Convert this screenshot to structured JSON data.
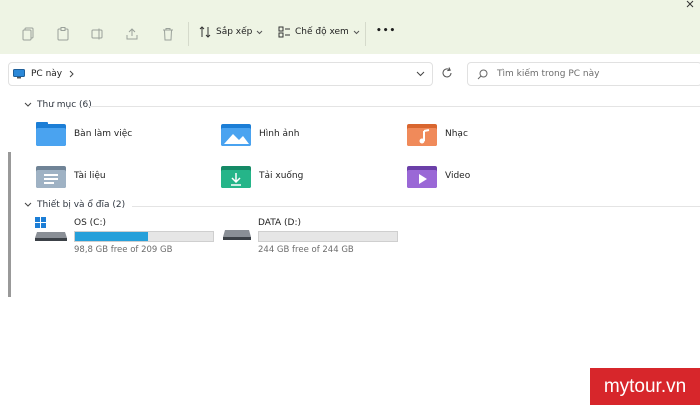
{
  "toolbar": {
    "sort_label": "Sắp xếp",
    "view_label": "Chế độ xem",
    "more_label": "•••"
  },
  "address": {
    "location": "PC này",
    "search_placeholder": "Tìm kiếm trong PC này"
  },
  "folders_section": {
    "title": "Thư mục (6)",
    "items": [
      {
        "label": "Bàn làm việc",
        "icon": "desktop-folder-icon"
      },
      {
        "label": "Hình ảnh",
        "icon": "pictures-folder-icon"
      },
      {
        "label": "Nhạc",
        "icon": "music-folder-icon"
      },
      {
        "label": "Tài liệu",
        "icon": "documents-folder-icon"
      },
      {
        "label": "Tải xuống",
        "icon": "downloads-folder-icon"
      },
      {
        "label": "Video",
        "icon": "videos-folder-icon"
      }
    ]
  },
  "drives_section": {
    "title": "Thiết bị và ổ đĩa (2)",
    "drives": [
      {
        "name": "OS (C:)",
        "free_text": "98,8 GB free of 209 GB",
        "used_fraction": 0.527
      },
      {
        "name": "DATA (D:)",
        "free_text": "244 GB free of 244 GB",
        "used_fraction": 0.0
      }
    ]
  },
  "watermark": "mytour.vn",
  "colors": {
    "toolbar_bg": "#eef4e4",
    "drive_bar": "#26a0da",
    "watermark_bg": "#d7262b"
  }
}
